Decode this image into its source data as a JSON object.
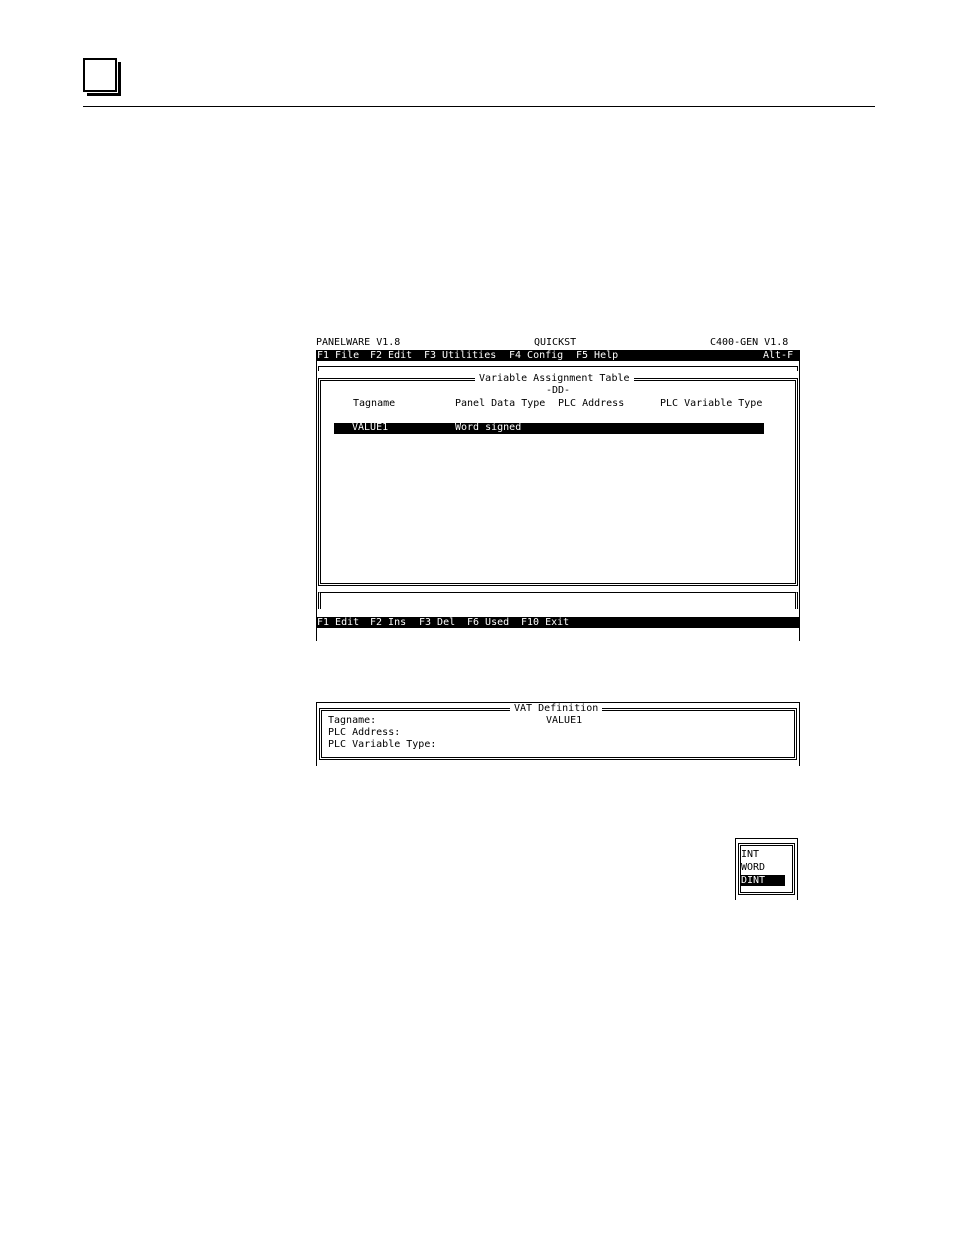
{
  "app": {
    "name": "PANELWARE V1.8",
    "project": "QUICKST",
    "target": "C400-GEN V1.8"
  },
  "menu": {
    "items": [
      "F1 File",
      "F2 Edit",
      "F3 Utilities",
      "F4 Config",
      "F5 Help"
    ],
    "shortcut": "Alt-F"
  },
  "vat_table": {
    "title": "Variable Assignment Table",
    "subtitle": "-DD-",
    "columns": [
      "Tagname",
      "Panel Data Type",
      "PLC Address",
      "PLC Variable Type"
    ],
    "rows": [
      {
        "tagname": "VALUE1",
        "panel_type": "Word signed",
        "plc_address": "",
        "plc_var_type": ""
      }
    ]
  },
  "function_keys": [
    "F1 Edit",
    "F2 Ins",
    "F3 Del",
    "F6 Used",
    "F10 Exit"
  ],
  "vat_definition": {
    "title": "VAT Definition",
    "tagname_label": "Tagname:",
    "tagname_value": "VALUE1",
    "plc_address_label": "PLC Address:",
    "plc_var_type_label": "PLC Variable Type:"
  },
  "type_popup": {
    "options": [
      "INT",
      "WORD",
      "DINT"
    ],
    "selected": "DINT"
  }
}
